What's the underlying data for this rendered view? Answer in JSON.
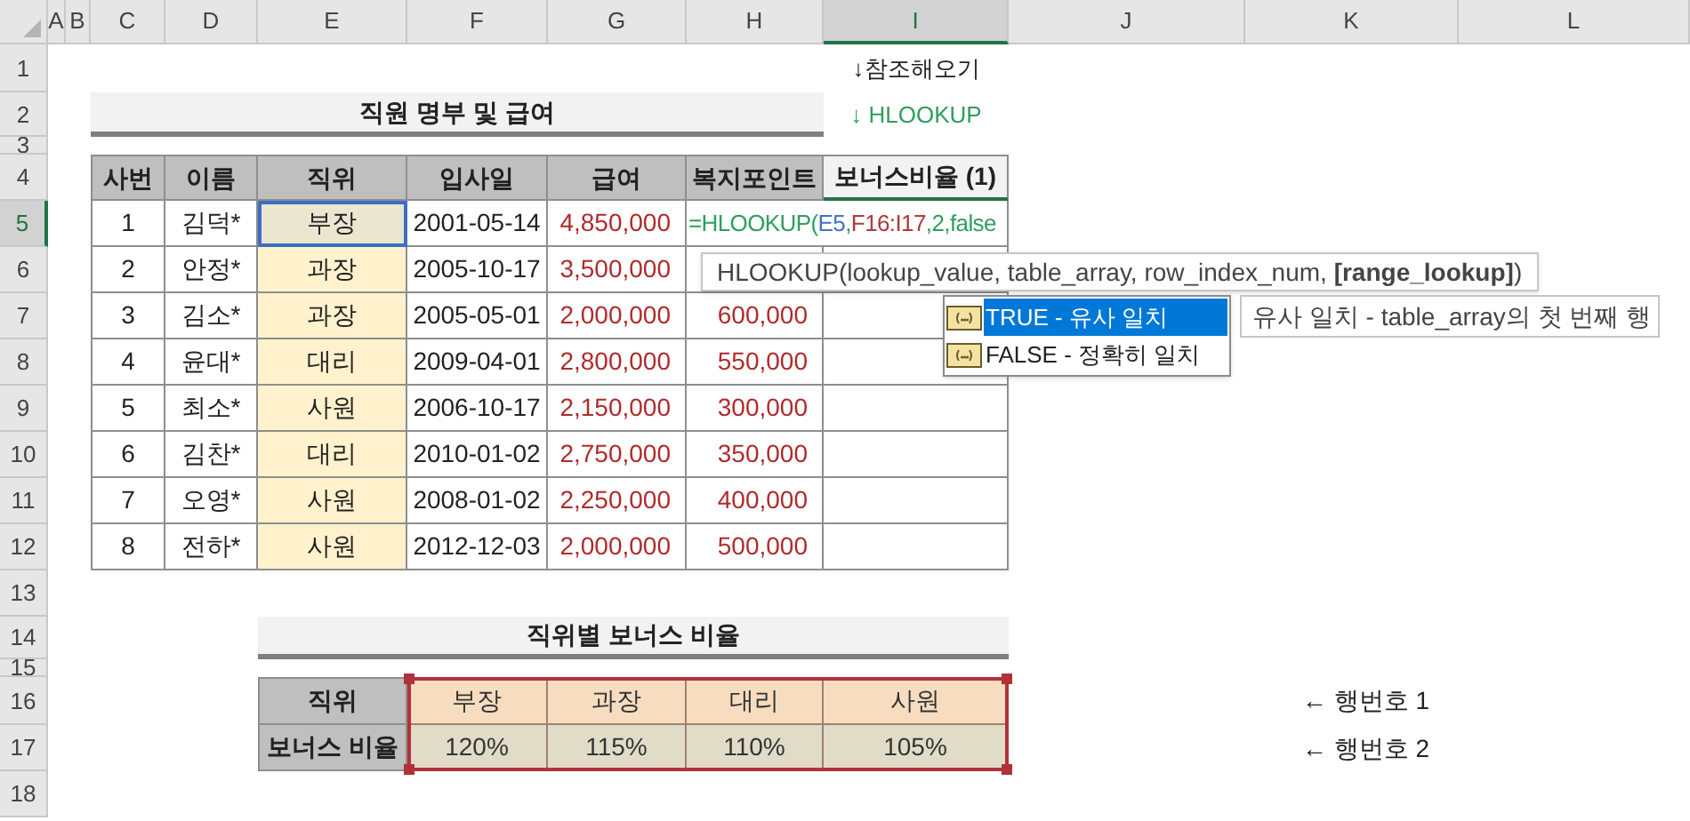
{
  "sheet": {
    "columns": [
      {
        "label": "A",
        "selected": false
      },
      {
        "label": "B",
        "selected": false
      },
      {
        "label": "C",
        "selected": false
      },
      {
        "label": "D",
        "selected": false
      },
      {
        "label": "E",
        "selected": false
      },
      {
        "label": "F",
        "selected": false
      },
      {
        "label": "G",
        "selected": false
      },
      {
        "label": "H",
        "selected": false
      },
      {
        "label": "I",
        "selected": true
      },
      {
        "label": "J",
        "selected": false
      },
      {
        "label": "K",
        "selected": false
      },
      {
        "label": "L",
        "selected": false
      }
    ],
    "rows": [
      {
        "label": "1",
        "selected": false
      },
      {
        "label": "2",
        "selected": false
      },
      {
        "label": "3",
        "selected": false
      },
      {
        "label": "4",
        "selected": false
      },
      {
        "label": "5",
        "selected": true
      },
      {
        "label": "6",
        "selected": false
      },
      {
        "label": "7",
        "selected": false
      },
      {
        "label": "8",
        "selected": false
      },
      {
        "label": "9",
        "selected": false
      },
      {
        "label": "10",
        "selected": false
      },
      {
        "label": "11",
        "selected": false
      },
      {
        "label": "12",
        "selected": false
      },
      {
        "label": "13",
        "selected": false
      },
      {
        "label": "14",
        "selected": false
      },
      {
        "label": "15",
        "selected": false
      },
      {
        "label": "16",
        "selected": false
      },
      {
        "label": "17",
        "selected": false
      },
      {
        "label": "18",
        "selected": false
      }
    ]
  },
  "notes": [
    {
      "text": "↓참조해오기",
      "kind": "plain"
    },
    {
      "text": "↓ HLOOKUP",
      "kind": "green"
    }
  ],
  "staff_table": {
    "title": "직원 명부 및 급여",
    "columns": [
      {
        "label": "사번",
        "kind": "dark"
      },
      {
        "label": "이름",
        "kind": "dark"
      },
      {
        "label": "직위",
        "kind": "dark"
      },
      {
        "label": "입사일",
        "kind": "dark"
      },
      {
        "label": "급여",
        "kind": "dark"
      },
      {
        "label": "복지포인트",
        "kind": "dark"
      },
      {
        "label": "보너스비율 (1)",
        "kind": "light"
      }
    ],
    "rows": [
      {
        "no": "1",
        "name": "김덕*",
        "position": "부장",
        "hired": "2001-05-14",
        "salary": "4,850,000",
        "highlighted": true
      },
      {
        "no": "2",
        "name": "안정*",
        "position": "과장",
        "hired": "2005-10-17",
        "salary": "3,500,000",
        "highlighted": false
      },
      {
        "no": "3",
        "name": "김소*",
        "position": "과장",
        "hired": "2005-05-01",
        "salary": "2,000,000",
        "points": "600,000",
        "highlighted": false
      },
      {
        "no": "4",
        "name": "윤대*",
        "position": "대리",
        "hired": "2009-04-01",
        "salary": "2,800,000",
        "points": "550,000",
        "highlighted": false
      },
      {
        "no": "5",
        "name": "최소*",
        "position": "사원",
        "hired": "2006-10-17",
        "salary": "2,150,000",
        "points": "300,000",
        "highlighted": false
      },
      {
        "no": "6",
        "name": "김찬*",
        "position": "대리",
        "hired": "2010-01-02",
        "salary": "2,750,000",
        "points": "350,000",
        "highlighted": false
      },
      {
        "no": "7",
        "name": "오영*",
        "position": "사원",
        "hired": "2008-01-02",
        "salary": "2,250,000",
        "points": "400,000",
        "highlighted": false
      },
      {
        "no": "8",
        "name": "전하*",
        "position": "사원",
        "hired": "2012-12-03",
        "salary": "2,000,000",
        "points": "500,000",
        "highlighted": false
      }
    ]
  },
  "formula_editor": {
    "segments": [
      {
        "text": "=HLOOKUP(",
        "color": "#2e9e5e"
      },
      {
        "text": "E5",
        "color": "#4472c4"
      },
      {
        "text": ",",
        "color": "#2e9e5e"
      },
      {
        "text": "F16:I17",
        "color": "#b03a3a"
      },
      {
        "text": ",2,false",
        "color": "#2e9e5e"
      }
    ]
  },
  "tooltip": {
    "text": "HLOOKUP(lookup_value, table_array, row_index_num, **[range_lookup]**)"
  },
  "autocomplete": {
    "items": [
      {
        "label": "TRUE - 유사 일치",
        "selected": true
      },
      {
        "label": "FALSE - 정확히 일치",
        "selected": false
      }
    ],
    "description": "유사 일치 - table_array의 첫 번째 행"
  },
  "bonus_table": {
    "title": "직위별 보너스 비율",
    "row_labels": [
      "직위",
      "보너스 비율"
    ],
    "positions": [
      "부장",
      "과장",
      "대리",
      "사원"
    ],
    "rates": [
      "120%",
      "115%",
      "110%",
      "105%"
    ],
    "notes": [
      "← 행번호 1",
      "← 행번호 2"
    ]
  }
}
